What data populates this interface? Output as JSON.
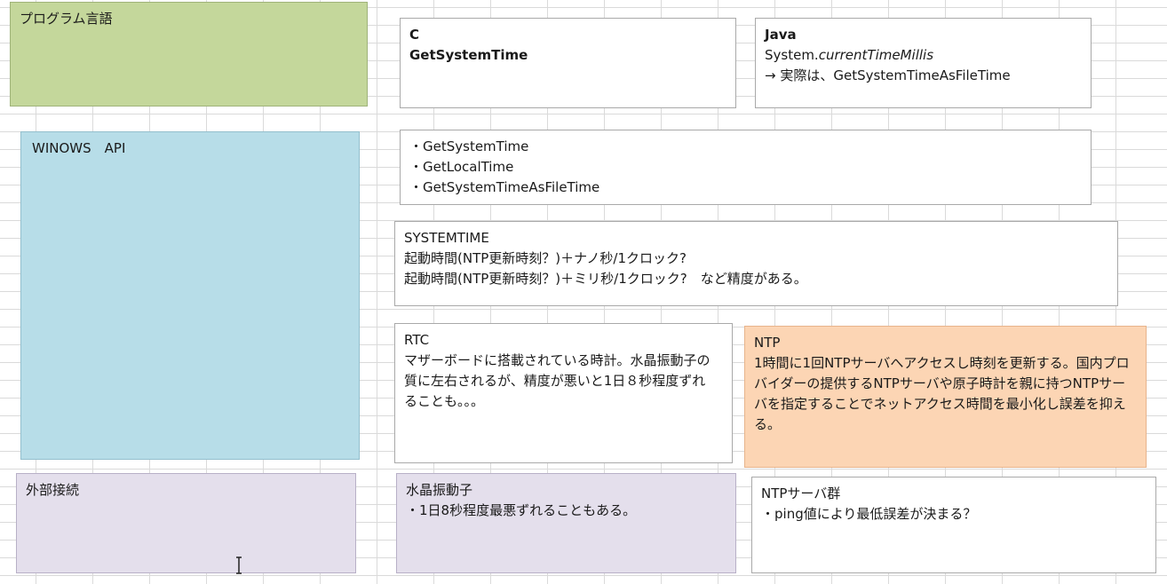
{
  "boxes": {
    "prog_lang": {
      "title": "プログラム言語"
    },
    "c_box": {
      "line1": "C",
      "line2": "GetSystemTime"
    },
    "java_box": {
      "title": "Java",
      "line2_prefix": "System.",
      "line2_italic": "currentTimeMillis",
      "line3": "→ 実際は、GetSystemTimeAsFileTime"
    },
    "winapi": {
      "title": "WINOWS　API"
    },
    "api_list": {
      "items": [
        "・GetSystemTime",
        "・GetLocalTime",
        "・GetSystemTimeAsFileTime"
      ]
    },
    "systemtime": {
      "title": "SYSTEMTIME",
      "line2": "起動時間(NTP更新時刻？)＋ナノ秒/1クロック?",
      "line3": "起動時間(NTP更新時刻？)＋ミリ秒/1クロック?　など精度がある。"
    },
    "rtc": {
      "title": "RTC",
      "body": "マザーボードに搭載されている時計。水晶振動子の質に左右されるが、精度が悪いと1日８秒程度ずれることも。。。"
    },
    "ntp": {
      "title": "NTP",
      "body": "1時間に1回NTPサーバへアクセスし時刻を更新する。国内プロバイダーの提供するNTPサーバや原子時計を親に持つNTPサーバを指定することでネットアクセス時間を最小化し誤差を抑える。"
    },
    "external": {
      "title": "外部接続"
    },
    "crystal": {
      "title": "水晶振動子",
      "body": "・1日8秒程度最悪ずれることもある。"
    },
    "ntp_servers": {
      "title": "NTPサーバ群",
      "body": "・ping値により最低誤差が決まる？"
    }
  },
  "colors": {
    "green": "#c4d79b",
    "blue": "#b7dde8",
    "lilac": "#e4dfec",
    "orange": "#fcd5b4"
  },
  "icons": {
    "cursor": "text-cursor-icon"
  }
}
